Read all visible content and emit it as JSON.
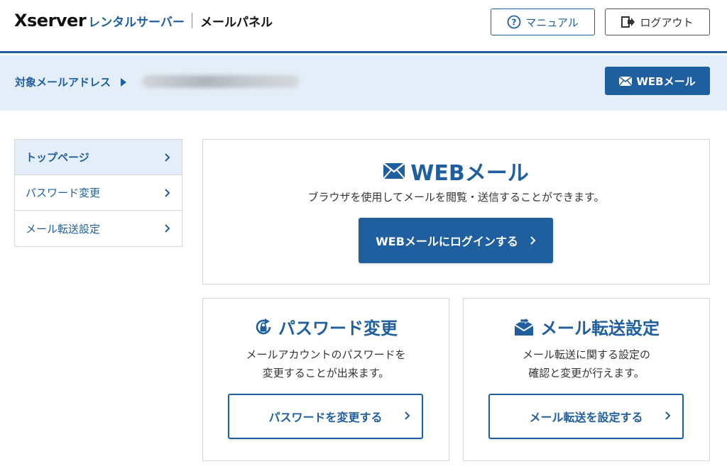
{
  "header": {
    "logo_brand": "Xserver",
    "logo_product": "レンタルサーバー",
    "logo_panel": "メールパネル",
    "manual_label": "マニュアル",
    "logout_label": "ログアウト"
  },
  "address_bar": {
    "label": "対象メールアドレス",
    "webmail_label": "WEBメール"
  },
  "sidebar": {
    "items": [
      {
        "label": "トップページ",
        "active": true
      },
      {
        "label": "パスワード変更",
        "active": false
      },
      {
        "label": "メール転送設定",
        "active": false
      }
    ]
  },
  "cards": {
    "webmail": {
      "title": "WEBメール",
      "description": "ブラウザを使用してメールを閲覧・送信することができます。",
      "button": "WEBメールにログインする"
    },
    "password": {
      "title": "パスワード変更",
      "description_line1": "メールアカウントのパスワードを",
      "description_line2": "変更することが出来ます。",
      "button": "パスワードを変更する"
    },
    "forward": {
      "title": "メール転送設定",
      "description_line1": "メール転送に関する設定の",
      "description_line2": "確認と変更が行えます。",
      "button": "メール転送を設定する"
    }
  },
  "colors": {
    "brand_blue": "#1f5f9f",
    "light_blue_bg": "#e4eef8",
    "border": "#d3d7dc"
  },
  "icons": {
    "manual": "question-circle-icon",
    "logout": "logout-icon",
    "mail": "envelope-icon",
    "password": "lock-refresh-icon",
    "forward": "mail-forward-icon",
    "chevron": "chevron-right-icon"
  }
}
